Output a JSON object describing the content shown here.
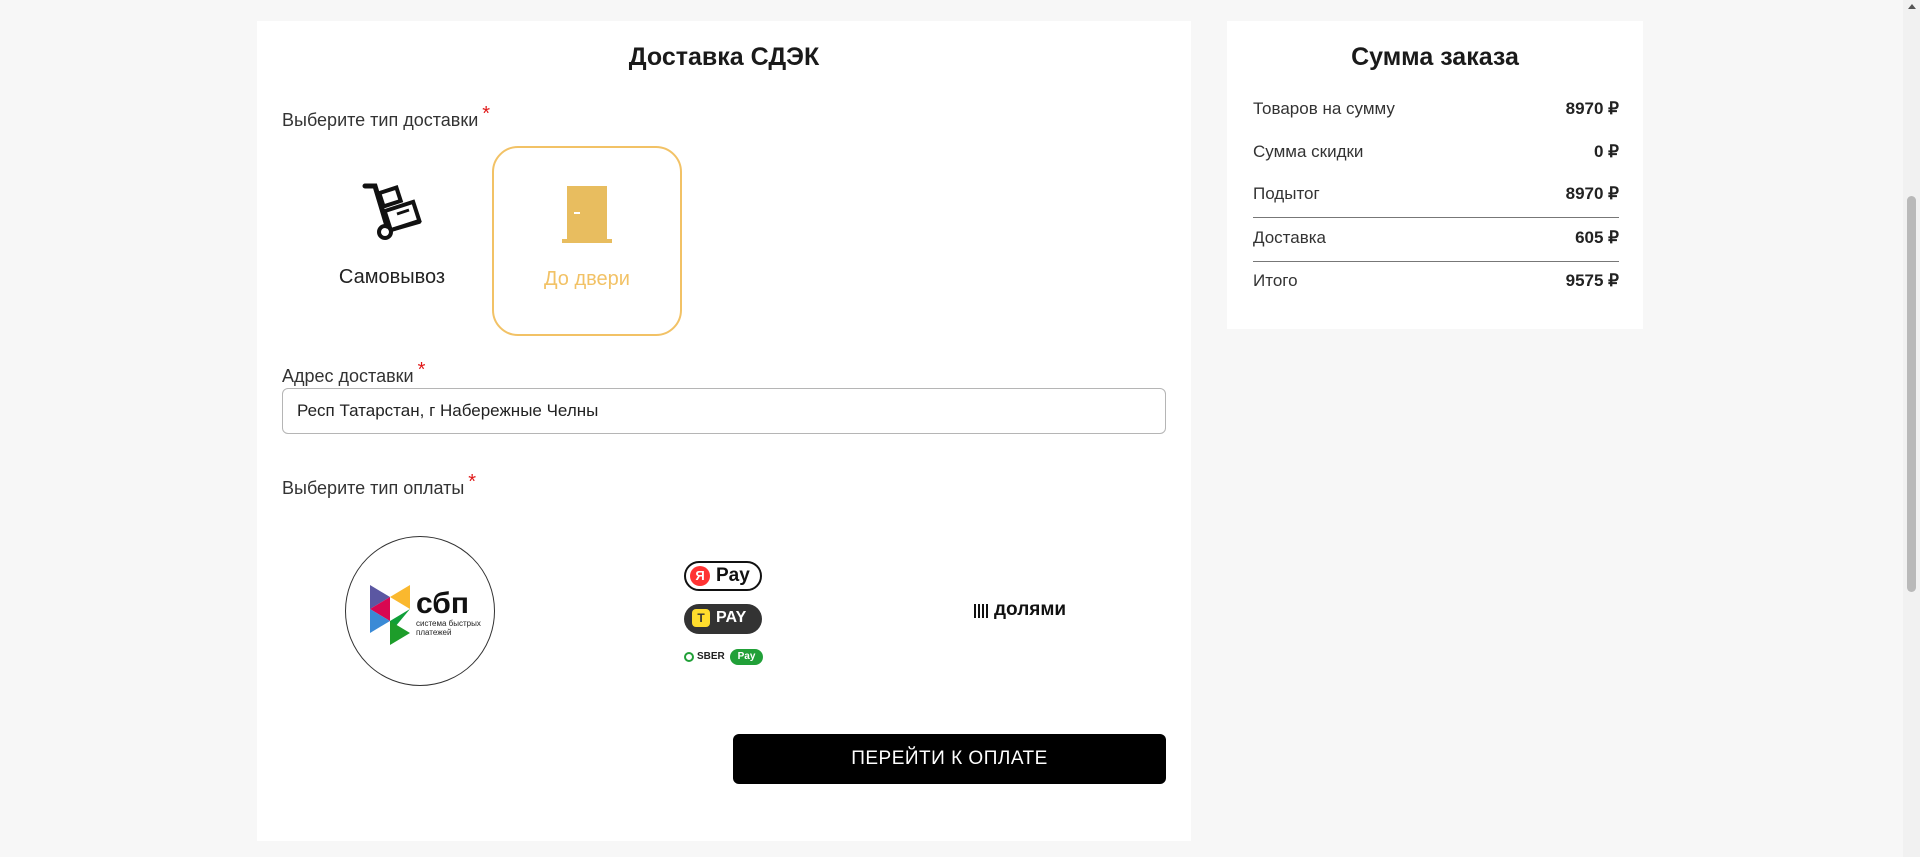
{
  "delivery": {
    "title": "Доставка СДЭК",
    "type_label": "Выберите тип доставки",
    "required_mark": "*",
    "options": [
      {
        "label": "Самовывоз",
        "icon": "hand-truck-icon",
        "selected": false
      },
      {
        "label": "До двери",
        "icon": "door-icon",
        "selected": true
      }
    ],
    "address_label": "Адрес доставки",
    "address_value": "Респ Татарстан, г Набережные Челны",
    "payment_label": "Выберите тип оплаты",
    "payment_options": [
      {
        "name": "sbp",
        "main_text": "сбп",
        "sub_text": "система быстрых платежей"
      },
      {
        "name": "pay-wallets",
        "ya_text": "Pay",
        "ya_letter": "Я",
        "t_text": "PAY",
        "t_letter": "Т",
        "sber_text": "SBER",
        "sber_pay": "Pay"
      },
      {
        "name": "dolyami",
        "text": "долями"
      }
    ],
    "submit_label": "ПЕРЕЙТИ К ОПЛАТЕ"
  },
  "summary": {
    "title": "Сумма заказа",
    "rows": [
      {
        "label": "Товаров на сумму",
        "value": "8970 ₽"
      },
      {
        "label": "Сумма скидки",
        "value": "0 ₽"
      },
      {
        "label": "Подытог",
        "value": "8970 ₽"
      },
      {
        "label": "Доставка",
        "value": "605 ₽"
      },
      {
        "label": "Итого",
        "value": "9575 ₽"
      }
    ]
  },
  "colors": {
    "accent": "#f2c266",
    "icon_fill": "#e8bd5f",
    "required": "#e01818",
    "button": "#000000"
  }
}
